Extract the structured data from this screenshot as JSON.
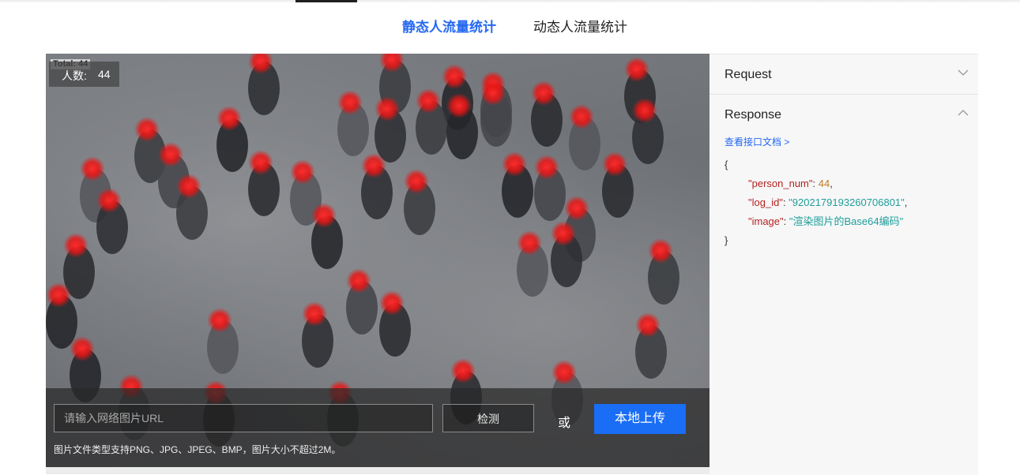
{
  "tabs": [
    {
      "label": "静态人流量统计",
      "active": true
    },
    {
      "label": "动态人流量统计",
      "active": false
    }
  ],
  "demo": {
    "total_tag": "Total: 44",
    "count_label": "人数:",
    "count_value": "44",
    "url_placeholder": "请输入网络图片URL",
    "detect_label": "检测",
    "or_label": "或",
    "upload_label": "本地上传",
    "hint": "图片文件类型支持PNG、JPG、JPEG、BMP，图片大小不超过2M。"
  },
  "side": {
    "request_title": "Request",
    "response_title": "Response",
    "doc_link": "查看接口文档 >",
    "json": {
      "open": "{",
      "close": "}",
      "entries": [
        {
          "key": "\"person_num\"",
          "value": "44",
          "type": "number",
          "trail": ","
        },
        {
          "key": "\"log_id\"",
          "value": "\"9202179193260706801\"",
          "type": "string",
          "trail": ","
        },
        {
          "key": "\"image\"",
          "value": "\"渲染图片的Base64编码\"",
          "type": "string",
          "trail": ""
        }
      ]
    }
  },
  "colors": {
    "accent": "#2468f2",
    "upload_button": "#1a6df5",
    "json_key": "#b4231f",
    "json_number": "#c27a22",
    "json_string": "#1f9e9a",
    "head_marker": "#ff1e1e"
  }
}
